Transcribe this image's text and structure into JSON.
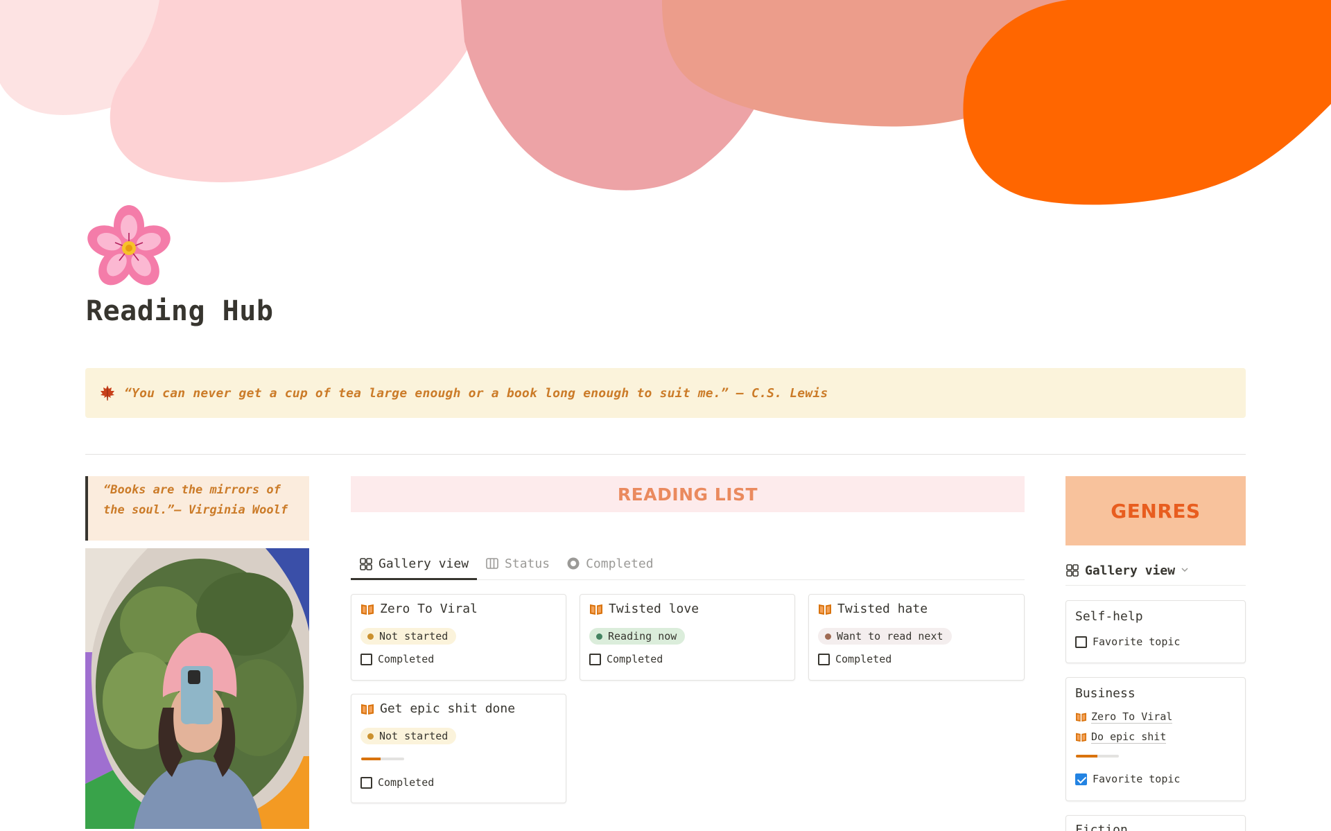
{
  "page": {
    "title": "Reading Hub",
    "icon": "cherry-blossom-icon"
  },
  "callout": {
    "icon": "maple-leaf-icon",
    "text": "“You can never get a cup of tea large enough or a book long enough to suit me.” — C.S. Lewis"
  },
  "left_column": {
    "quote": "“Books are the mirrors of the soul.”— Virginia Woolf"
  },
  "reading_list": {
    "header": "READING LIST",
    "tabs": [
      {
        "label": "Gallery view",
        "icon": "gallery-icon",
        "active": true
      },
      {
        "label": "Status",
        "icon": "board-icon",
        "active": false
      },
      {
        "label": "Completed",
        "icon": "circle-status-icon",
        "active": false
      }
    ],
    "cards": [
      {
        "title": "Zero To Viral",
        "status": "Not started",
        "status_color": "#cb912f",
        "checkbox_label": "Completed",
        "checked": false
      },
      {
        "title": "Twisted love",
        "status": "Reading now",
        "status_color": "#448361",
        "checkbox_label": "Completed",
        "checked": false
      },
      {
        "title": "Twisted hate",
        "status": "Want to read next",
        "status_color": "#9f6b53",
        "checkbox_label": "Completed",
        "checked": false
      },
      {
        "title": "Get epic shit done",
        "status": "Not started",
        "status_color": "#cb912f",
        "progress": 0.45,
        "checkbox_label": "Completed",
        "checked": false
      }
    ]
  },
  "genres": {
    "header": "GENRES",
    "view_label": "Gallery view",
    "cards": [
      {
        "title": "Self-help",
        "books": [],
        "checkbox_label": "Favorite topic",
        "checked": false
      },
      {
        "title": "Business",
        "books": [
          "Zero To Viral",
          "Do epic shit"
        ],
        "progress": 0.5,
        "checkbox_label": "Favorite topic",
        "checked": true
      },
      {
        "title": "Fiction"
      }
    ]
  },
  "colors": {
    "accent_orange": "#ff6a00",
    "callout_bg": "#fbf3db",
    "quote_text": "#cb7b28",
    "reading_list_header": "#ea8a5e",
    "genres_header_bg": "#f8c29c",
    "genres_header_text": "#e85d1f"
  }
}
